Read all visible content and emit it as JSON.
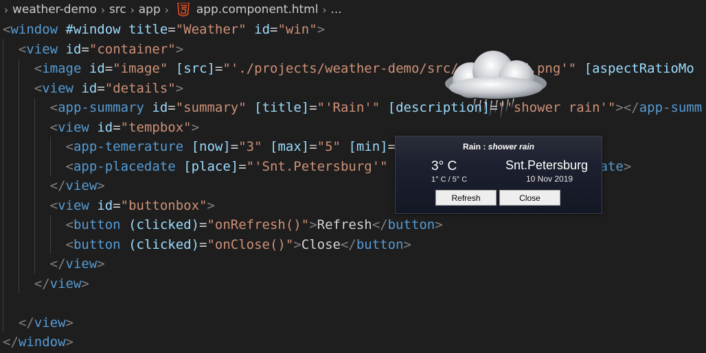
{
  "breadcrumb": {
    "items": [
      "weather-demo",
      "src",
      "app",
      "app.component.html",
      "..."
    ],
    "separator": ">",
    "file_icon": "html5-icon",
    "file_icon_color": "#e44d26"
  },
  "code": {
    "lines": [
      [
        [
          "t-punct",
          "<"
        ],
        [
          "t-tag",
          "window"
        ],
        [
          "t-text",
          " "
        ],
        [
          "t-attr",
          "#window"
        ],
        [
          "t-text",
          " "
        ],
        [
          "t-attr",
          "title"
        ],
        [
          "t-eq",
          "="
        ],
        [
          "t-str",
          "\"Weather\""
        ],
        [
          "t-text",
          " "
        ],
        [
          "t-attr",
          "id"
        ],
        [
          "t-eq",
          "="
        ],
        [
          "t-str",
          "\"win\""
        ],
        [
          "t-punct",
          ">"
        ]
      ],
      [
        [
          "t-text",
          "  "
        ],
        [
          "t-punct",
          "<"
        ],
        [
          "t-tag",
          "view"
        ],
        [
          "t-text",
          " "
        ],
        [
          "t-attr",
          "id"
        ],
        [
          "t-eq",
          "="
        ],
        [
          "t-str",
          "\"container\""
        ],
        [
          "t-punct",
          ">"
        ]
      ],
      [
        [
          "t-text",
          "    "
        ],
        [
          "t-punct",
          "<"
        ],
        [
          "t-tag",
          "image"
        ],
        [
          "t-text",
          " "
        ],
        [
          "t-attr",
          "id"
        ],
        [
          "t-eq",
          "="
        ],
        [
          "t-str",
          "\"image\""
        ],
        [
          "t-text",
          " "
        ],
        [
          "t-attr",
          "[src]"
        ],
        [
          "t-eq",
          "="
        ],
        [
          "t-str",
          "\"'./projects/weather-demo/src/"
        ],
        [
          "t-str",
          "        "
        ],
        [
          "t-str",
          "d.png'\""
        ],
        [
          "t-text",
          " "
        ],
        [
          "t-attr",
          "[aspectRatioMo"
        ]
      ],
      [
        [
          "t-text",
          "    "
        ],
        [
          "t-punct",
          "<"
        ],
        [
          "t-tag",
          "view"
        ],
        [
          "t-text",
          " "
        ],
        [
          "t-attr",
          "id"
        ],
        [
          "t-eq",
          "="
        ],
        [
          "t-str",
          "\"details\""
        ],
        [
          "t-punct",
          ">"
        ]
      ],
      [
        [
          "t-text",
          "      "
        ],
        [
          "t-punct",
          "<"
        ],
        [
          "t-tag",
          "app-summary"
        ],
        [
          "t-text",
          " "
        ],
        [
          "t-attr",
          "id"
        ],
        [
          "t-eq",
          "="
        ],
        [
          "t-str",
          "\"summary\""
        ],
        [
          "t-text",
          " "
        ],
        [
          "t-attr",
          "[title]"
        ],
        [
          "t-eq",
          "="
        ],
        [
          "t-str",
          "\"'Rain'\""
        ],
        [
          "t-text",
          " "
        ],
        [
          "t-attr",
          "[description]"
        ],
        [
          "t-eq",
          "="
        ],
        [
          "t-str",
          "\"'shower rain'\""
        ],
        [
          "t-punct",
          "></"
        ],
        [
          "t-tag",
          "app-summ"
        ]
      ],
      [
        [
          "t-text",
          "      "
        ],
        [
          "t-punct",
          "<"
        ],
        [
          "t-tag",
          "view"
        ],
        [
          "t-text",
          " "
        ],
        [
          "t-attr",
          "id"
        ],
        [
          "t-eq",
          "="
        ],
        [
          "t-str",
          "\"tempbox\""
        ],
        [
          "t-punct",
          ">"
        ]
      ],
      [
        [
          "t-text",
          "        "
        ],
        [
          "t-punct",
          "<"
        ],
        [
          "t-tag",
          "app-temerature"
        ],
        [
          "t-text",
          " "
        ],
        [
          "t-attr",
          "[now]"
        ],
        [
          "t-eq",
          "="
        ],
        [
          "t-str",
          "\"3\""
        ],
        [
          "t-text",
          " "
        ],
        [
          "t-attr",
          "[max]"
        ],
        [
          "t-eq",
          "="
        ],
        [
          "t-str",
          "\"5\""
        ],
        [
          "t-text",
          " "
        ],
        [
          "t-attr",
          "[min]"
        ],
        [
          "t-eq",
          "="
        ],
        [
          "t-str",
          "\"1\""
        ],
        [
          "t-punct",
          "></"
        ],
        [
          "t-tag",
          "app-temerature"
        ],
        [
          "t-punct",
          ">"
        ]
      ],
      [
        [
          "t-text",
          "        "
        ],
        [
          "t-punct",
          "<"
        ],
        [
          "t-tag",
          "app-placedate"
        ],
        [
          "t-text",
          " "
        ],
        [
          "t-attr",
          "[place]"
        ],
        [
          "t-eq",
          "="
        ],
        [
          "t-str",
          "\"'Snt.Petersburg'\""
        ],
        [
          "t-text",
          " "
        ],
        [
          "t-attr",
          "[date]"
        ],
        [
          "t-eq",
          "="
        ],
        [
          "t-str",
          "\"date\""
        ],
        [
          "t-punct",
          "></"
        ],
        [
          "t-tag",
          "app-placedate"
        ],
        [
          "t-punct",
          ">"
        ]
      ],
      [
        [
          "t-text",
          "      "
        ],
        [
          "t-punct",
          "</"
        ],
        [
          "t-tag",
          "view"
        ],
        [
          "t-punct",
          ">"
        ]
      ],
      [
        [
          "t-text",
          "      "
        ],
        [
          "t-punct",
          "<"
        ],
        [
          "t-tag",
          "view"
        ],
        [
          "t-text",
          " "
        ],
        [
          "t-attr",
          "id"
        ],
        [
          "t-eq",
          "="
        ],
        [
          "t-str",
          "\"buttonbox\""
        ],
        [
          "t-punct",
          ">"
        ]
      ],
      [
        [
          "t-text",
          "        "
        ],
        [
          "t-punct",
          "<"
        ],
        [
          "t-tag",
          "button"
        ],
        [
          "t-text",
          " "
        ],
        [
          "t-attr",
          "(clicked)"
        ],
        [
          "t-eq",
          "="
        ],
        [
          "t-str",
          "\"onRefresh()\""
        ],
        [
          "t-punct",
          ">"
        ],
        [
          "t-text",
          "Refresh"
        ],
        [
          "t-punct",
          "</"
        ],
        [
          "t-tag",
          "button"
        ],
        [
          "t-punct",
          ">"
        ]
      ],
      [
        [
          "t-text",
          "        "
        ],
        [
          "t-punct",
          "<"
        ],
        [
          "t-tag",
          "button"
        ],
        [
          "t-text",
          " "
        ],
        [
          "t-attr",
          "(clicked)"
        ],
        [
          "t-eq",
          "="
        ],
        [
          "t-str",
          "\"onClose()\""
        ],
        [
          "t-punct",
          ">"
        ],
        [
          "t-text",
          "Close"
        ],
        [
          "t-punct",
          "</"
        ],
        [
          "t-tag",
          "button"
        ],
        [
          "t-punct",
          ">"
        ]
      ],
      [
        [
          "t-text",
          "      "
        ],
        [
          "t-punct",
          "</"
        ],
        [
          "t-tag",
          "view"
        ],
        [
          "t-punct",
          ">"
        ]
      ],
      [
        [
          "t-text",
          "    "
        ],
        [
          "t-punct",
          "</"
        ],
        [
          "t-tag",
          "view"
        ],
        [
          "t-punct",
          ">"
        ]
      ],
      [
        [
          "t-text",
          ""
        ]
      ],
      [
        [
          "t-text",
          "  "
        ],
        [
          "t-punct",
          "</"
        ],
        [
          "t-tag",
          "view"
        ],
        [
          "t-punct",
          ">"
        ]
      ],
      [
        [
          "t-punct",
          "</"
        ],
        [
          "t-tag",
          "window"
        ],
        [
          "t-punct",
          ">"
        ]
      ]
    ]
  },
  "weather": {
    "summary_title": "Rain",
    "summary_sep": " : ",
    "summary_description": "shower rain",
    "temperature_now": "3° C",
    "temperature_range": "1° C / 5° C",
    "place": "Snt.Petersburg",
    "date": "10 Nov 2019",
    "refresh_label": "Refresh",
    "close_label": "Close",
    "icon": "rain-cloud-icon"
  }
}
